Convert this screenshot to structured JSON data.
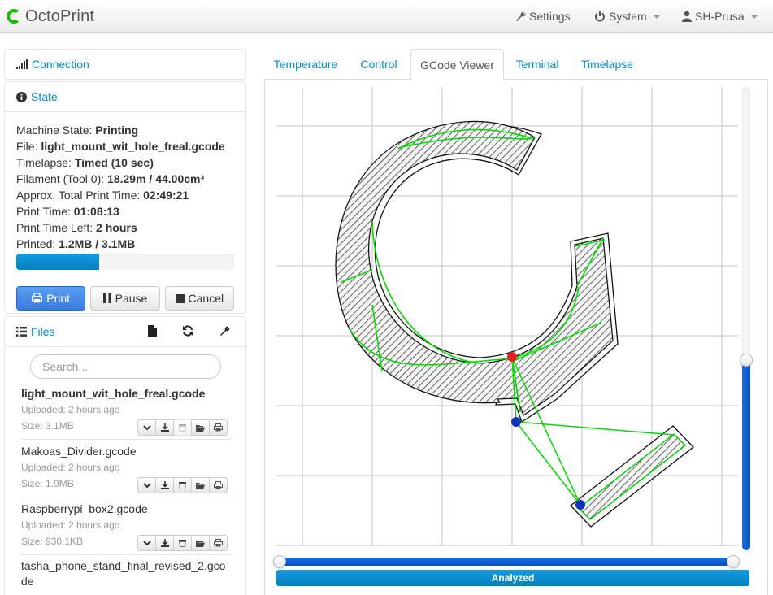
{
  "navbar": {
    "brand": "OctoPrint",
    "settings_label": "Settings",
    "system_label": "System",
    "user_label": "SH-Prusa"
  },
  "sidebar": {
    "connection_title": "Connection",
    "state_title": "State",
    "state": [
      {
        "label": "Machine State: ",
        "value": "Printing"
      },
      {
        "label": "File: ",
        "value": "light_mount_wit_hole_freal.gcode"
      },
      {
        "label": "Timelapse: ",
        "value": "Timed (10 sec)"
      },
      {
        "label": "Filament (Tool 0): ",
        "value": "18.29m / 44.00cm³"
      },
      {
        "label": "Approx. Total Print Time: ",
        "value": "02:49:21"
      },
      {
        "label": "Print Time: ",
        "value": "01:08:13"
      },
      {
        "label": "Print Time Left: ",
        "value": "2 hours"
      },
      {
        "label": "Printed: ",
        "value": "1.2MB / 3.1MB"
      }
    ],
    "progress_fraction": 0.38,
    "buttons": {
      "print": "Print",
      "pause": "Pause",
      "cancel": "Cancel"
    },
    "files_title": "Files",
    "search_placeholder": "Search...",
    "files": [
      {
        "name": "light_mount_wit_hole_freal.gcode",
        "uploaded": "Uploaded: 2 hours ago",
        "size": "Size: 3.1MB",
        "selected": true
      },
      {
        "name": "Makoas_Divider.gcode",
        "uploaded": "Uploaded: 2 hours ago",
        "size": "Size: 1.9MB",
        "selected": false
      },
      {
        "name": "Raspberrypi_box2.gcode",
        "uploaded": "Uploaded: 2 hours ago",
        "size": "Size: 930.1KB",
        "selected": false
      },
      {
        "name": "tasha_phone_stand_final_revised_2.gcode",
        "uploaded": "",
        "size": "",
        "selected": false
      }
    ]
  },
  "tabs": [
    "Temperature",
    "Control",
    "GCode Viewer",
    "Terminal",
    "Timelapse"
  ],
  "active_tab": "GCode Viewer",
  "viewer": {
    "analyzed_label": "Analyzed",
    "layer_slider_fraction": 0.41
  },
  "colors": {
    "accent": "#0088cc",
    "toolpath": "#00e000",
    "progress": "#0480be",
    "primary_button": "#4a8ae8"
  }
}
